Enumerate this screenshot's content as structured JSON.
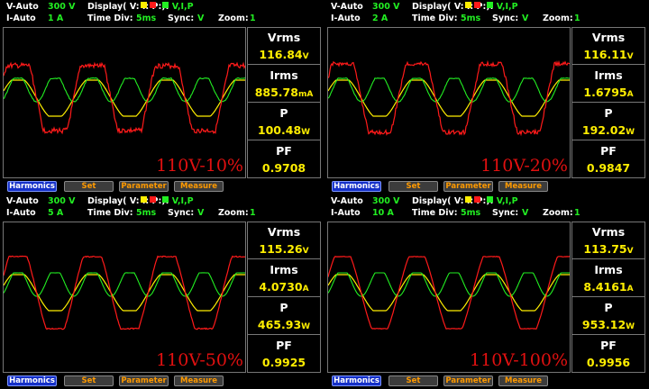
{
  "colors": {
    "voltage": "#ffee00",
    "current": "#ff1a1a",
    "power": "#22ee22",
    "buttonActive": "#1530c8",
    "buttonText": "#ff9a00"
  },
  "header_labels": {
    "display": "Display(",
    "v": "V:",
    "i": "I:",
    "p": "P:",
    "close": "):",
    "time_div": "Time Div:",
    "sync": "Sync:",
    "zoom": "Zoom:"
  },
  "right_labels": {
    "vrms": "Vrms",
    "irms": "Irms",
    "p": "P",
    "pf": "PF"
  },
  "buttons": [
    "Harmonics",
    "Set",
    "Parameter",
    "Measure"
  ],
  "quadrants": [
    {
      "v_mode": "V-Auto",
      "v_range": "300 V",
      "i_mode": "I-Auto",
      "i_range": "1 A",
      "display": "V,I,P",
      "time_div": "5ms",
      "sync": "V",
      "zoom": "1",
      "vrms": "116.84",
      "vrms_unit": "V",
      "irms": "885.78",
      "irms_unit": "mA",
      "p": "100.48",
      "p_unit": "W",
      "pf": "0.9708",
      "note": "110V-10%",
      "current_scale": 0.9,
      "current_clip": 0.55,
      "noise": 0.22
    },
    {
      "v_mode": "V-Auto",
      "v_range": "300 V",
      "i_mode": "I-Auto",
      "i_range": "2 A",
      "display": "V,I,P",
      "time_div": "5ms",
      "sync": "V",
      "zoom": "1",
      "vrms": "116.11",
      "vrms_unit": "V",
      "irms": "1.6795",
      "irms_unit": "A",
      "p": "192.02",
      "p_unit": "W",
      "pf": "0.9847",
      "note": "110V-20%",
      "current_scale": 0.95,
      "current_clip": 0.6,
      "noise": 0.18
    },
    {
      "v_mode": "V-Auto",
      "v_range": "300 V",
      "i_mode": "I-Auto",
      "i_range": "5 A",
      "display": "V,I,P",
      "time_div": "5ms",
      "sync": "V",
      "zoom": "1",
      "vrms": "115.26",
      "vrms_unit": "V",
      "irms": "4.0730",
      "irms_unit": "A",
      "p": "465.93",
      "p_unit": "W",
      "pf": "0.9925",
      "note": "110V-50%",
      "current_scale": 1.0,
      "current_clip": 0.72,
      "noise": 0.05
    },
    {
      "v_mode": "V-Auto",
      "v_range": "300 V",
      "i_mode": "I-Auto",
      "i_range": "10 A",
      "display": "V,I,P",
      "time_div": "5ms",
      "sync": "V",
      "zoom": "1",
      "vrms": "113.75",
      "vrms_unit": "V",
      "irms": "8.4161",
      "irms_unit": "A",
      "p": "953.12",
      "p_unit": "W",
      "pf": "0.9956",
      "note": "110V-100%",
      "current_scale": 1.0,
      "current_clip": 0.78,
      "noise": 0.02
    }
  ]
}
